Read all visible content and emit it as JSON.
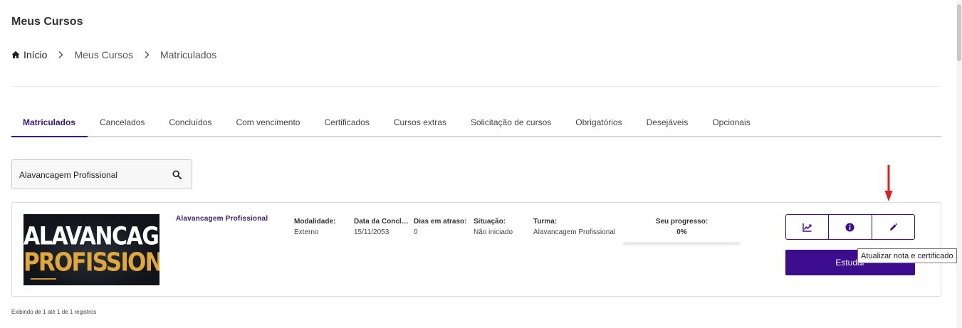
{
  "page": {
    "title": "Meus Cursos"
  },
  "breadcrumb": {
    "items": [
      "Início",
      "Meus Cursos",
      "Matriculados"
    ]
  },
  "tabs": [
    {
      "label": "Matriculados",
      "active": true
    },
    {
      "label": "Cancelados"
    },
    {
      "label": "Concluídos"
    },
    {
      "label": "Com vencimento"
    },
    {
      "label": "Certificados"
    },
    {
      "label": "Cursos extras"
    },
    {
      "label": "Solicitação de cursos"
    },
    {
      "label": "Obrigatórios"
    },
    {
      "label": "Desejáveis"
    },
    {
      "label": "Opcionais"
    }
  ],
  "search": {
    "value": "Alavancagem Profissional",
    "icon": "search-icon"
  },
  "course": {
    "thumbnail": {
      "line1": "ALAVANCAGEM",
      "line2": "PROFISSIONAL"
    },
    "name": "Alavancagem Profissional",
    "fields": [
      {
        "label": "Modalidade:",
        "value": "Externo"
      },
      {
        "label": "Data da Conclusão:",
        "value": "15/11/2053"
      },
      {
        "label": "Dias em atraso:",
        "value": "0"
      },
      {
        "label": "Situação:",
        "value": "Não iniciado"
      },
      {
        "label": "Turma:",
        "value": "Alavancagem Profissional"
      }
    ],
    "progress": {
      "label": "Seu progresso:",
      "value_text": "0%",
      "value": 0
    },
    "actions": [
      {
        "icon": "chart-line-icon"
      },
      {
        "icon": "info-icon"
      },
      {
        "icon": "pencil-icon"
      }
    ],
    "study_label": "Estudar"
  },
  "tooltip": {
    "text": "Atualizar nota e certificado"
  },
  "footer": {
    "info": "Exibindo de 1 até 1 de 1 registros"
  },
  "colors": {
    "accent": "#3c0d8f",
    "annotation": "#e41e1e"
  }
}
